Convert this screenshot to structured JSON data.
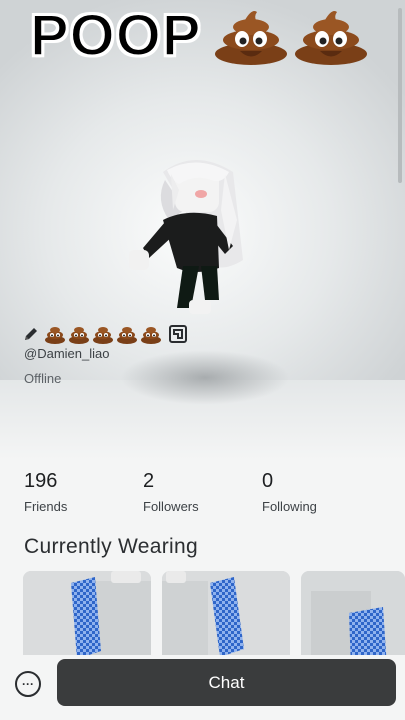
{
  "overlay": {
    "title": "POOP"
  },
  "profile": {
    "username": "@Damien_liao",
    "status": "Offline",
    "emoji_count": 5
  },
  "stats": [
    {
      "value": "196",
      "label": "Friends"
    },
    {
      "value": "2",
      "label": "Followers"
    },
    {
      "value": "0",
      "label": "Following"
    }
  ],
  "wearing": {
    "title": "Currently Wearing"
  },
  "actions": {
    "chat_label": "Chat",
    "more_icon": "ellipsis-icon"
  },
  "colors": {
    "chat_button": "#3a3c3d",
    "poop": "#8b4a1c"
  }
}
